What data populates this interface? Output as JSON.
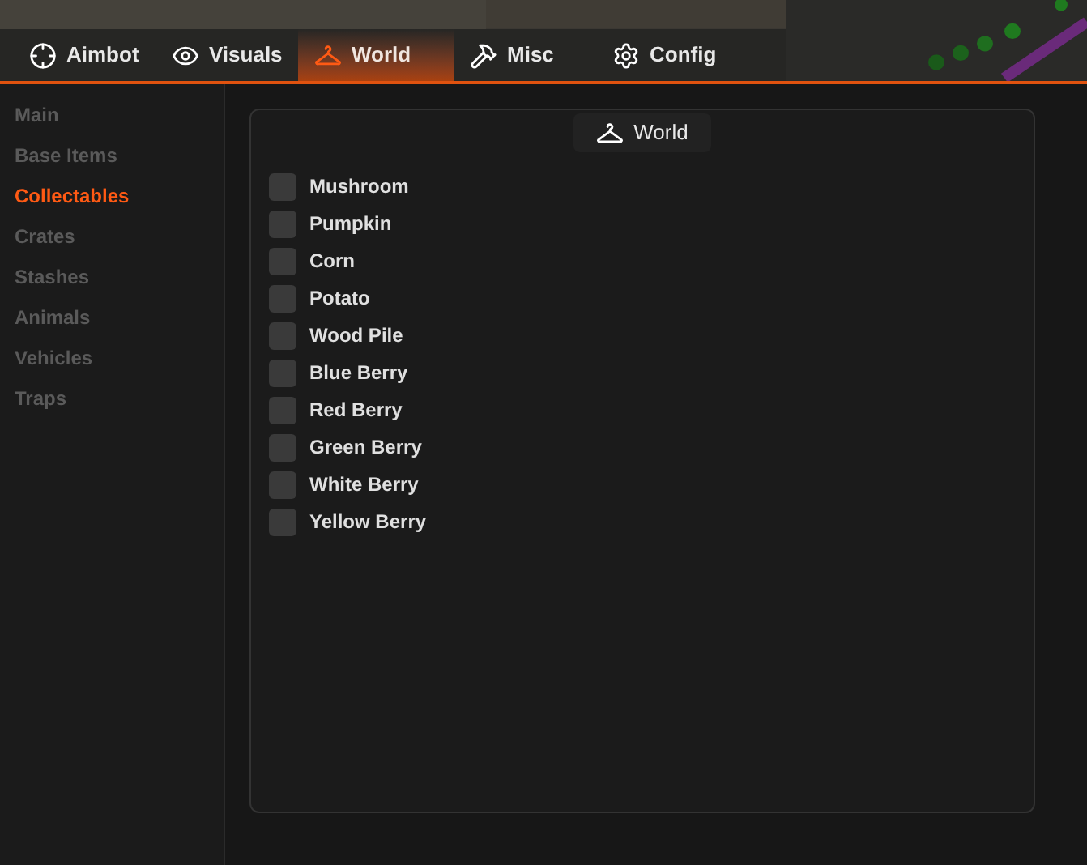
{
  "tabs": [
    {
      "label": "Aimbot",
      "kind": "aim",
      "selected": false
    },
    {
      "label": "Visuals",
      "kind": "visuals",
      "selected": false
    },
    {
      "label": "World",
      "kind": "world",
      "selected": true
    },
    {
      "label": "Misc",
      "kind": "misc",
      "selected": false
    },
    {
      "label": "Config",
      "kind": "config",
      "selected": false
    }
  ],
  "sidebar": {
    "items": [
      {
        "label": "Main",
        "selected": false
      },
      {
        "label": "Base Items",
        "selected": false
      },
      {
        "label": "Collectables",
        "selected": true
      },
      {
        "label": "Crates",
        "selected": false
      },
      {
        "label": "Stashes",
        "selected": false
      },
      {
        "label": "Animals",
        "selected": false
      },
      {
        "label": "Vehicles",
        "selected": false
      },
      {
        "label": "Traps",
        "selected": false
      }
    ]
  },
  "panel": {
    "title": "World",
    "kind": "world",
    "options": [
      {
        "label": "Mushroom",
        "checked": false
      },
      {
        "label": "Pumpkin",
        "checked": false
      },
      {
        "label": "Corn",
        "checked": false
      },
      {
        "label": "Potato",
        "checked": false
      },
      {
        "label": "Wood Pile",
        "checked": false
      },
      {
        "label": "Blue Berry",
        "checked": false
      },
      {
        "label": "Red Berry",
        "checked": false
      },
      {
        "label": "Green Berry",
        "checked": false
      },
      {
        "label": "White Berry",
        "checked": false
      },
      {
        "label": "Yellow Berry",
        "checked": false
      }
    ]
  }
}
